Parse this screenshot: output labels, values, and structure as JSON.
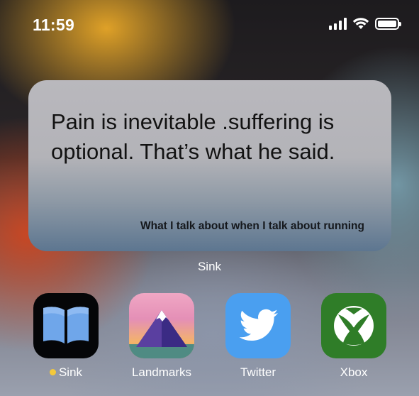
{
  "status_bar": {
    "time": "11:59",
    "icons": [
      "cellular-signal-icon",
      "wifi-icon",
      "battery-icon"
    ]
  },
  "widget": {
    "quote": "Pain is inevitable .suffering is optional. That’s what he said.",
    "source": "What I talk about when I talk about running",
    "app_label": "Sink"
  },
  "dock_apps": [
    {
      "label": "Sink",
      "icon": "book-icon",
      "has_dot": true,
      "dot_color": "#f4c93b"
    },
    {
      "label": "Landmarks",
      "icon": "mountain-icon"
    },
    {
      "label": "Twitter",
      "icon": "twitter-bird-icon",
      "color": "#4a9ff0"
    },
    {
      "label": "Xbox",
      "icon": "xbox-icon",
      "color": "#2f7d28"
    }
  ]
}
